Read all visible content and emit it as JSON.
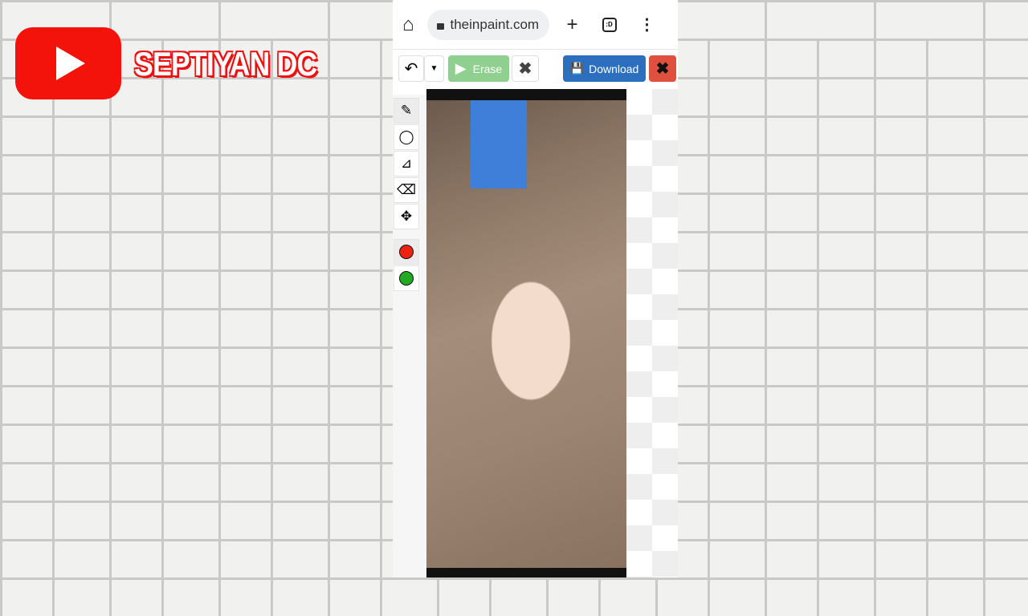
{
  "overlay": {
    "channel_name": "SEPTIYAN DC",
    "logo": "youtube-logo"
  },
  "browser": {
    "url": "theinpaint.com",
    "tabs_count": ":D"
  },
  "toolbar": {
    "erase_label": "Erase",
    "download_label": "Download"
  },
  "tools": [
    "marker-icon",
    "lasso-icon",
    "polygon-lasso-icon",
    "eraser-icon",
    "move-icon"
  ],
  "colors": {
    "red_marker": "#ee2211",
    "green_marker": "#22aa22",
    "download": "#2d6fbf",
    "close": "#e0503f",
    "erase": "#8fcf8f"
  }
}
